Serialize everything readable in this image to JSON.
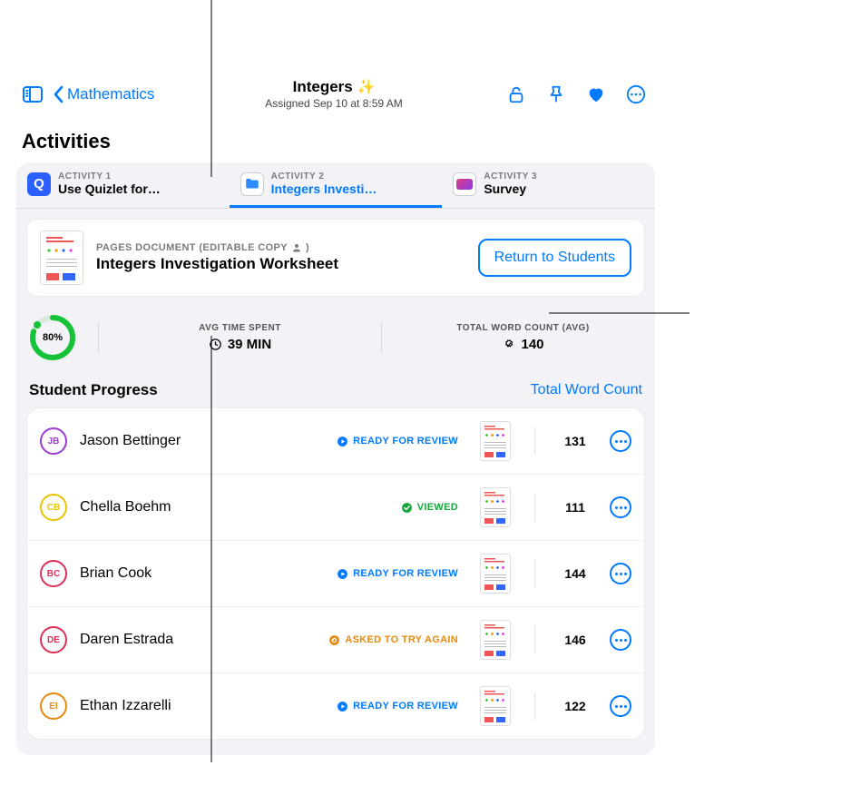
{
  "header": {
    "back_label": "Mathematics",
    "title": "Integers",
    "subtitle": "Assigned Sep 10 at 8:59 AM"
  },
  "section_title": "Activities",
  "tabs": [
    {
      "overline": "ACTIVITY 1",
      "title": "Use Quizlet for…"
    },
    {
      "overline": "ACTIVITY 2",
      "title": "Integers Investi…"
    },
    {
      "overline": "ACTIVITY 3",
      "title": "Survey"
    }
  ],
  "document": {
    "overline": "PAGES DOCUMENT (EDITABLE COPY",
    "overline_suffix": ")",
    "title": "Integers Investigation Worksheet",
    "return_label": "Return to Students"
  },
  "stats": {
    "progress_pct_label": "80%",
    "progress_pct": 80,
    "time_overline": "AVG TIME SPENT",
    "time_value": "39 MIN",
    "words_overline": "TOTAL WORD COUNT (AVG)",
    "words_value": "140"
  },
  "student_progress": {
    "title": "Student Progress",
    "filter_label": "Total Word Count"
  },
  "status_labels": {
    "review": "READY FOR REVIEW",
    "viewed": "VIEWED",
    "again": "ASKED TO TRY AGAIN"
  },
  "students": [
    {
      "initials": "JB",
      "name": "Jason Bettinger",
      "status": "review",
      "count": "131",
      "ring": "#9b3bd1"
    },
    {
      "initials": "CB",
      "name": "Chella Boehm",
      "status": "viewed",
      "count": "111",
      "ring": "#e8c400"
    },
    {
      "initials": "BC",
      "name": "Brian Cook",
      "status": "review",
      "count": "144",
      "ring": "#e02f57"
    },
    {
      "initials": "DE",
      "name": "Daren Estrada",
      "status": "again",
      "count": "146",
      "ring": "#e02f57"
    },
    {
      "initials": "EI",
      "name": "Ethan Izzarelli",
      "status": "review",
      "count": "122",
      "ring": "#e8890c"
    }
  ]
}
